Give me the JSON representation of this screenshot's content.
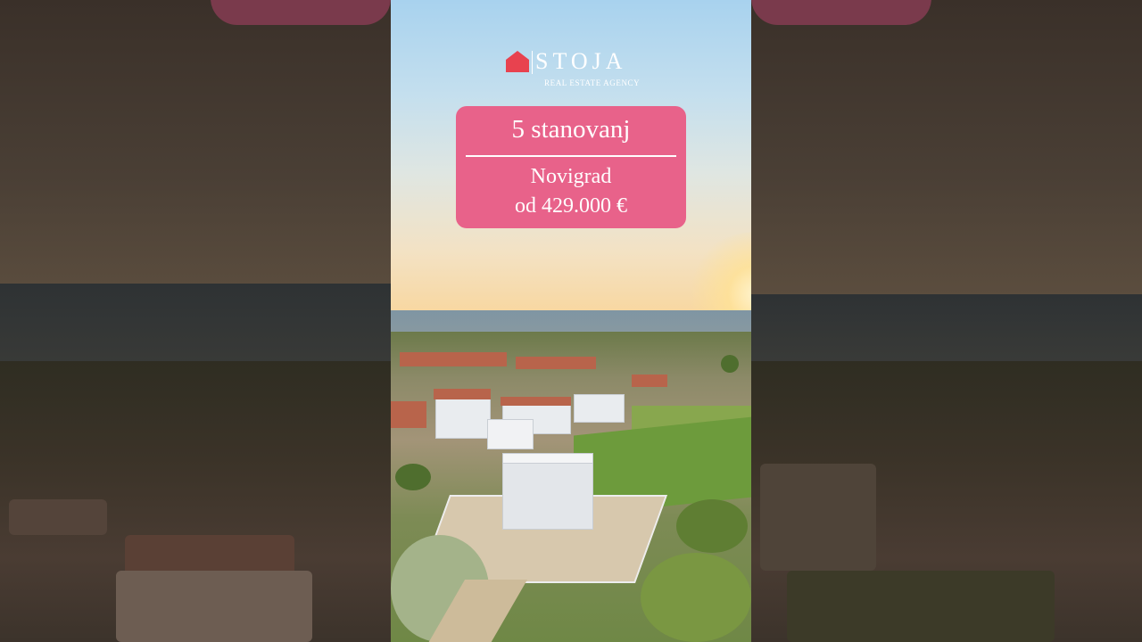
{
  "logo": {
    "name": "STOJA",
    "tagline": "REAL ESTATE AGENCY",
    "brand_color": "#e8424f"
  },
  "card": {
    "title": "5 stanovanj",
    "location": "Novigrad",
    "price": "od 429.000 €",
    "background_color": "#e8628a"
  }
}
